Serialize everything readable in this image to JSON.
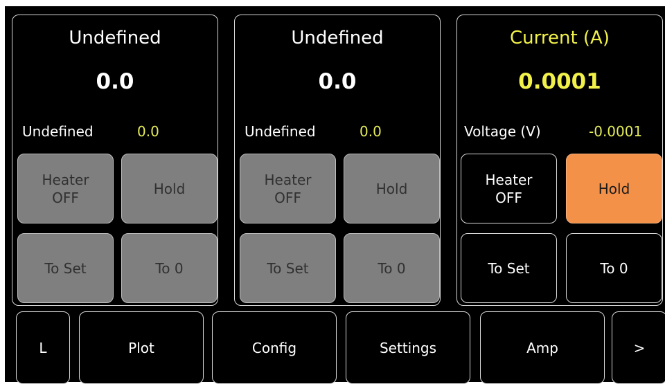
{
  "panels": [
    {
      "title": "Undefined",
      "value": "0.0",
      "sub_label": "Undefined",
      "sub_value": "0.0",
      "heater_label_1": "Heater",
      "heater_label_2": "OFF",
      "hold_label": "Hold",
      "to_set_label": "To Set",
      "to_zero_label": "To 0",
      "state": "disabled"
    },
    {
      "title": "Undefined",
      "value": "0.0",
      "sub_label": "Undefined",
      "sub_value": "0.0",
      "heater_label_1": "Heater",
      "heater_label_2": "OFF",
      "hold_label": "Hold",
      "to_set_label": "To Set",
      "to_zero_label": "To 0",
      "state": "disabled"
    },
    {
      "title": "Current (A)",
      "value": "0.0001",
      "sub_label": "Voltage (V)",
      "sub_value": "-0.0001",
      "heater_label_1": "Heater",
      "heater_label_2": "OFF",
      "hold_label": "Hold",
      "to_set_label": "To Set",
      "to_zero_label": "To 0",
      "state": "active",
      "hold_active": true
    }
  ],
  "nav": {
    "l_label": "L",
    "plot_label": "Plot",
    "config_label": "Config",
    "settings_label": "Settings",
    "amp_label": "Amp",
    "next_label": ">"
  },
  "colors": {
    "background": "#000000",
    "text": "#ffffff",
    "accent_yellow": "#e4ec5a",
    "active_title_yellow": "#f1f14a",
    "button_gray": "#7f7f7f",
    "hold_active_orange": "#f39149"
  }
}
